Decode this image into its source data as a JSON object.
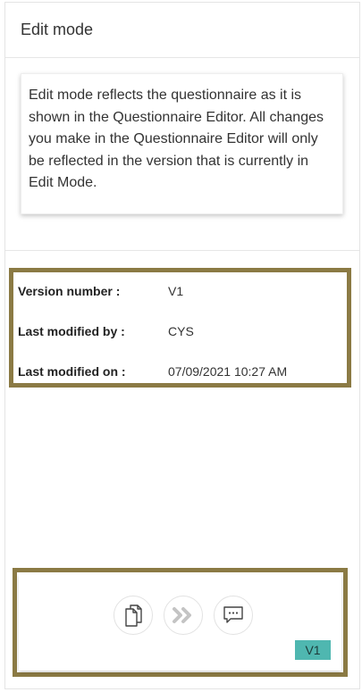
{
  "panel": {
    "title": "Edit mode"
  },
  "info": {
    "text": "Edit mode reflects the questionnaire as it is shown in the Questionnaire Editor. All changes you make in the Questionnaire Editor will only be reflected in the version that is currently in Edit Mode."
  },
  "details": {
    "rows": [
      {
        "label": "Version number :",
        "value": "V1"
      },
      {
        "label": "Last modified by :",
        "value": "CYS"
      },
      {
        "label": "Last modified on :",
        "value": "07/09/2021 10:27 AM"
      }
    ]
  },
  "actions": {
    "buttons": [
      {
        "icon": "copy-document-icon",
        "enabled": true
      },
      {
        "icon": "double-chevron-right-icon",
        "enabled": false
      },
      {
        "icon": "comment-icon",
        "enabled": true
      }
    ],
    "version_tag": "V1"
  },
  "colors": {
    "highlight_border": "#8b7a44",
    "version_tag_bg": "#4fb7b0"
  }
}
